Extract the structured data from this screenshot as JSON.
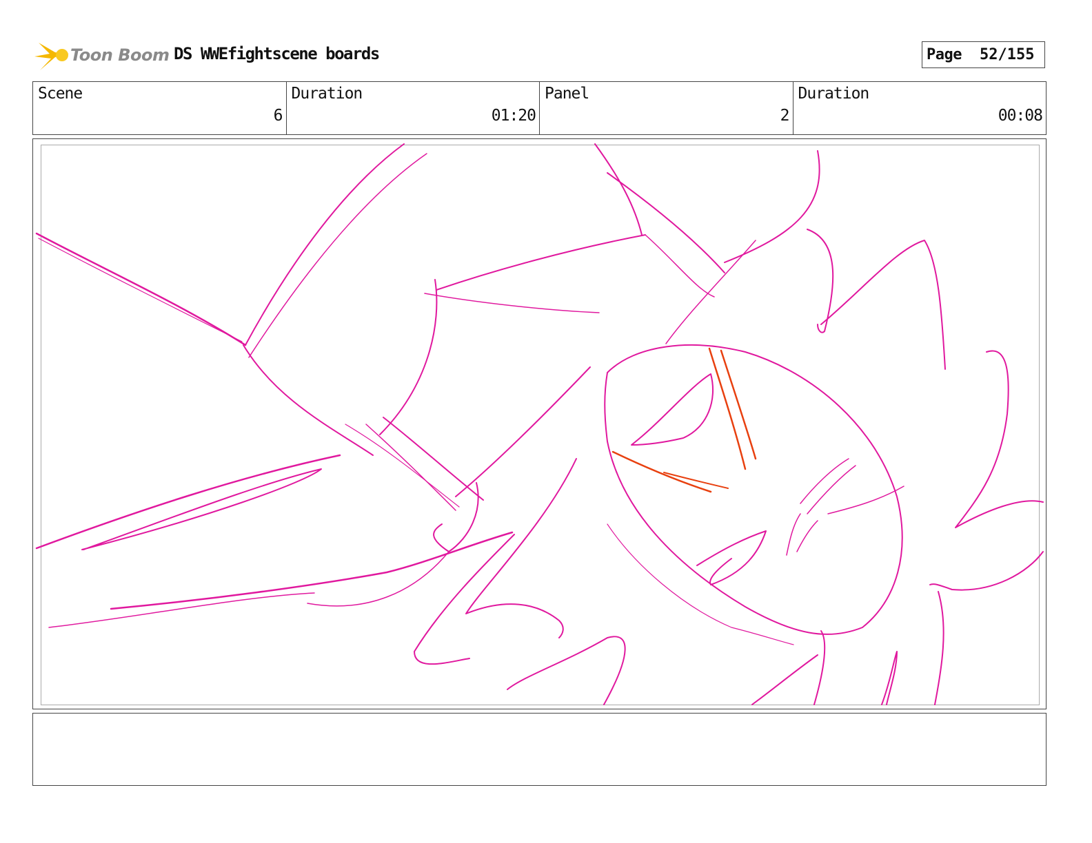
{
  "header": {
    "logo_text": "Toon Boom",
    "title": "DS WWEfightscene boards",
    "page_label": "Page",
    "page_value": "52/155"
  },
  "info": {
    "scene_label": "Scene",
    "scene_value": "6",
    "scene_duration_label": "Duration",
    "scene_duration_value": "01:20",
    "panel_label": "Panel",
    "panel_value": "2",
    "panel_duration_label": "Duration",
    "panel_duration_value": "00:08"
  },
  "colors": {
    "sketch_main": "#e0189e",
    "sketch_accent": "#e8400f",
    "logo_star": "#f5b800"
  },
  "notes": ""
}
